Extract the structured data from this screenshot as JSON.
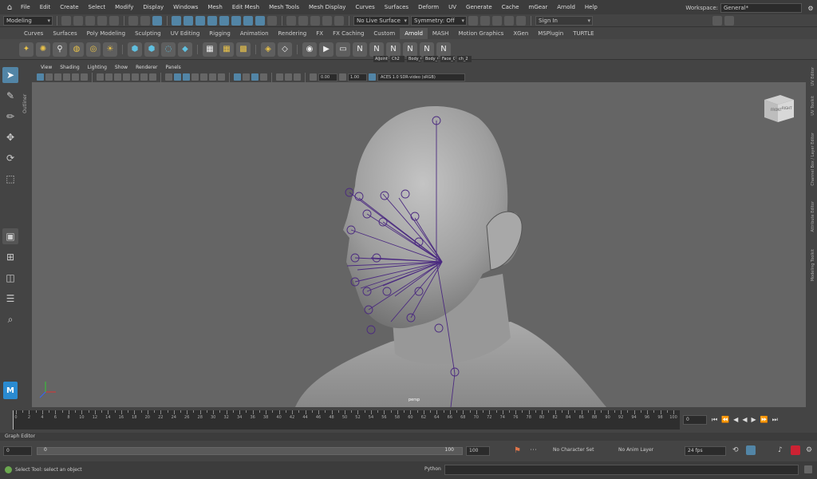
{
  "menubar": {
    "items": [
      "File",
      "Edit",
      "Create",
      "Select",
      "Modify",
      "Display",
      "Windows",
      "Mesh",
      "Edit Mesh",
      "Mesh Tools",
      "Mesh Display",
      "Curves",
      "Surfaces",
      "Deform",
      "UV",
      "Generate",
      "Cache",
      "mGear",
      "Arnold",
      "Help"
    ],
    "workspace_label": "Workspace:",
    "workspace_value": "General*"
  },
  "statusline": {
    "menuset": "Modeling",
    "live_surface": "No Live Surface",
    "symmetry": "Symmetry: Off",
    "sign_in": "Sign In"
  },
  "shelf": {
    "tabs": [
      "Curves",
      "Surfaces",
      "Poly Modeling",
      "Sculpting",
      "UV Editing",
      "Rigging",
      "Animation",
      "Rendering",
      "FX",
      "FX Caching",
      "Custom",
      "Arnold",
      "MASH",
      "Motion Graphics",
      "XGen",
      "MSPlugin",
      "TURTLE"
    ],
    "active_tab": "Arnold",
    "labels": [
      "AlJoint",
      "Ch2",
      "Body_Ct",
      "Body_Ct",
      "Face_Ct",
      "ch_2"
    ]
  },
  "panel": {
    "menus": [
      "View",
      "Shading",
      "Lighting",
      "Show",
      "Renderer",
      "Panels"
    ],
    "near_value": "0.00",
    "gamma_value": "1.00",
    "color_space": "ACES 1.0 SDR-video (sRGB)"
  },
  "outliner_tab": "Outliner",
  "viewcube": {
    "front": "FRONT",
    "right": "RIGHT"
  },
  "viewport": {
    "label": "persp"
  },
  "right_tabs": [
    "UV Editor",
    "UV Toolkit",
    "Channel Box / Layer Editor",
    "Attribute Editor",
    "Modeling Toolkit"
  ],
  "timeslider": {
    "ticks": [
      "0",
      "2",
      "4",
      "6",
      "8",
      "10",
      "12",
      "14",
      "16",
      "18",
      "20",
      "22",
      "24",
      "26",
      "28",
      "30",
      "32",
      "34",
      "36",
      "38",
      "40",
      "42",
      "44",
      "46",
      "48",
      "50",
      "52",
      "54",
      "56",
      "58",
      "60",
      "62",
      "64",
      "66",
      "68",
      "70",
      "72",
      "74",
      "76",
      "78",
      "80",
      "82",
      "84",
      "86",
      "88",
      "90",
      "92",
      "94",
      "96",
      "98",
      "100"
    ],
    "current_frame": "0"
  },
  "graph_editor_label": "Graph Editor",
  "range": {
    "start": "0",
    "inner_start": "0",
    "inner_end": "100",
    "end": "100",
    "character_set": "No Character Set",
    "anim_layer": "No Anim Layer",
    "fps": "24 fps"
  },
  "helpline": "Select Tool: select an object",
  "command_line": {
    "label": "Python"
  }
}
